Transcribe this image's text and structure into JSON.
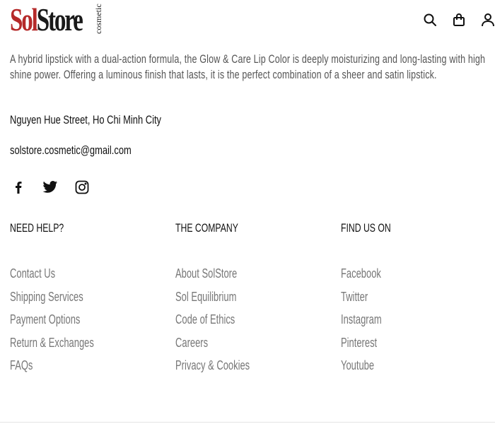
{
  "brand": {
    "logo_part1": "Sol",
    "logo_part2": "Store",
    "logo_sub": "cosmetic",
    "logo_color": "#b52a2a"
  },
  "header": {
    "icons": [
      "search-icon",
      "shopping-bag-icon",
      "user-icon"
    ]
  },
  "about": {
    "description": "A hybrid lipstick with a dual-action formula, the Glow & Care Lip Color is deeply moisturizing and long-lasting with high shine power. Offering a luminous finish that lasts, it is the perfect combination of a sheer and satin lipstick.",
    "address": "Nguyen Hue Street, Ho Chi Minh City",
    "email": "solstore.cosmetic@gmail.com"
  },
  "social": {
    "icons": [
      "facebook-icon",
      "twitter-icon",
      "instagram-icon"
    ]
  },
  "footer": {
    "columns": [
      {
        "title": "NEED HELP?",
        "links": [
          "Contact Us",
          "Shipping Services",
          "Payment Options",
          "Return & Exchanges",
          "FAQs"
        ]
      },
      {
        "title": "THE COMPANY",
        "links": [
          "About SolStore",
          "Sol Equilibrium",
          "Code of Ethics",
          "Careers",
          "Privacy & Cookies"
        ]
      },
      {
        "title": "FIND US ON",
        "links": [
          "Facebook",
          "Twitter",
          "Instagram",
          "Pinterest",
          "Youtube"
        ]
      }
    ]
  }
}
